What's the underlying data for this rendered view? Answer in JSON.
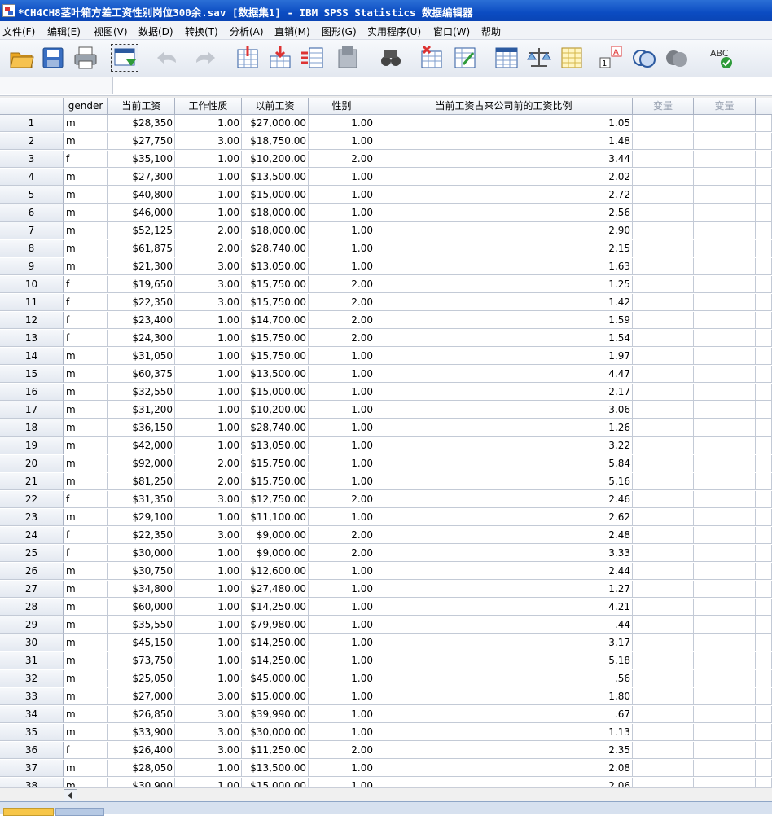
{
  "window": {
    "title": "*CH4CH8茎叶箱方差工资性别岗位300余.sav [数据集1] - IBM SPSS Statistics 数据编辑器"
  },
  "menu": [
    "文件(F)",
    "编辑(E)",
    "视图(V)",
    "数据(D)",
    "转换(T)",
    "分析(A)",
    "直销(M)",
    "图形(G)",
    "实用程序(U)",
    "窗口(W)",
    "帮助"
  ],
  "toolbar": [
    "open-folder-icon",
    "save-icon",
    "print-icon",
    "recall-dialog-icon",
    "undo-icon",
    "redo-icon",
    "goto-case-icon",
    "goto-variable-icon",
    "variables-icon",
    "run-descriptives-icon",
    "find-icon",
    "insert-cases-icon",
    "insert-variable-icon",
    "split-file-icon",
    "weight-cases-icon",
    "select-cases-icon",
    "value-labels-icon",
    "use-variable-sets-icon",
    "show-all-variables-icon",
    "spell-check-icon"
  ],
  "columns": [
    "gender",
    "当前工资",
    "工作性质",
    "以前工资",
    "性别",
    "当前工资占来公司前的工资比例",
    "变量",
    "变量"
  ],
  "rows": [
    [
      "1",
      "m",
      "$28,350",
      "1.00",
      "$27,000.00",
      "1.00",
      "1.05"
    ],
    [
      "2",
      "m",
      "$27,750",
      "3.00",
      "$18,750.00",
      "1.00",
      "1.48"
    ],
    [
      "3",
      "f",
      "$35,100",
      "1.00",
      "$10,200.00",
      "2.00",
      "3.44"
    ],
    [
      "4",
      "m",
      "$27,300",
      "1.00",
      "$13,500.00",
      "1.00",
      "2.02"
    ],
    [
      "5",
      "m",
      "$40,800",
      "1.00",
      "$15,000.00",
      "1.00",
      "2.72"
    ],
    [
      "6",
      "m",
      "$46,000",
      "1.00",
      "$18,000.00",
      "1.00",
      "2.56"
    ],
    [
      "7",
      "m",
      "$52,125",
      "2.00",
      "$18,000.00",
      "1.00",
      "2.90"
    ],
    [
      "8",
      "m",
      "$61,875",
      "2.00",
      "$28,740.00",
      "1.00",
      "2.15"
    ],
    [
      "9",
      "m",
      "$21,300",
      "3.00",
      "$13,050.00",
      "1.00",
      "1.63"
    ],
    [
      "10",
      "f",
      "$19,650",
      "3.00",
      "$15,750.00",
      "2.00",
      "1.25"
    ],
    [
      "11",
      "f",
      "$22,350",
      "3.00",
      "$15,750.00",
      "2.00",
      "1.42"
    ],
    [
      "12",
      "f",
      "$23,400",
      "1.00",
      "$14,700.00",
      "2.00",
      "1.59"
    ],
    [
      "13",
      "f",
      "$24,300",
      "1.00",
      "$15,750.00",
      "2.00",
      "1.54"
    ],
    [
      "14",
      "m",
      "$31,050",
      "1.00",
      "$15,750.00",
      "1.00",
      "1.97"
    ],
    [
      "15",
      "m",
      "$60,375",
      "1.00",
      "$13,500.00",
      "1.00",
      "4.47"
    ],
    [
      "16",
      "m",
      "$32,550",
      "1.00",
      "$15,000.00",
      "1.00",
      "2.17"
    ],
    [
      "17",
      "m",
      "$31,200",
      "1.00",
      "$10,200.00",
      "1.00",
      "3.06"
    ],
    [
      "18",
      "m",
      "$36,150",
      "1.00",
      "$28,740.00",
      "1.00",
      "1.26"
    ],
    [
      "19",
      "m",
      "$42,000",
      "1.00",
      "$13,050.00",
      "1.00",
      "3.22"
    ],
    [
      "20",
      "m",
      "$92,000",
      "2.00",
      "$15,750.00",
      "1.00",
      "5.84"
    ],
    [
      "21",
      "m",
      "$81,250",
      "2.00",
      "$15,750.00",
      "1.00",
      "5.16"
    ],
    [
      "22",
      "f",
      "$31,350",
      "3.00",
      "$12,750.00",
      "2.00",
      "2.46"
    ],
    [
      "23",
      "m",
      "$29,100",
      "1.00",
      "$11,100.00",
      "1.00",
      "2.62"
    ],
    [
      "24",
      "f",
      "$22,350",
      "3.00",
      "$9,000.00",
      "2.00",
      "2.48"
    ],
    [
      "25",
      "f",
      "$30,000",
      "1.00",
      "$9,000.00",
      "2.00",
      "3.33"
    ],
    [
      "26",
      "m",
      "$30,750",
      "1.00",
      "$12,600.00",
      "1.00",
      "2.44"
    ],
    [
      "27",
      "m",
      "$34,800",
      "1.00",
      "$27,480.00",
      "1.00",
      "1.27"
    ],
    [
      "28",
      "m",
      "$60,000",
      "1.00",
      "$14,250.00",
      "1.00",
      "4.21"
    ],
    [
      "29",
      "m",
      "$35,550",
      "1.00",
      "$79,980.00",
      "1.00",
      ".44"
    ],
    [
      "30",
      "m",
      "$45,150",
      "1.00",
      "$14,250.00",
      "1.00",
      "3.17"
    ],
    [
      "31",
      "m",
      "$73,750",
      "1.00",
      "$14,250.00",
      "1.00",
      "5.18"
    ],
    [
      "32",
      "m",
      "$25,050",
      "1.00",
      "$45,000.00",
      "1.00",
      ".56"
    ],
    [
      "33",
      "m",
      "$27,000",
      "3.00",
      "$15,000.00",
      "1.00",
      "1.80"
    ],
    [
      "34",
      "m",
      "$26,850",
      "3.00",
      "$39,990.00",
      "1.00",
      ".67"
    ],
    [
      "35",
      "m",
      "$33,900",
      "3.00",
      "$30,000.00",
      "1.00",
      "1.13"
    ],
    [
      "36",
      "f",
      "$26,400",
      "3.00",
      "$11,250.00",
      "2.00",
      "2.35"
    ],
    [
      "37",
      "m",
      "$28,050",
      "1.00",
      "$13,500.00",
      "1.00",
      "2.08"
    ],
    [
      "38",
      "m",
      "$30,900",
      "1.00",
      "$15,000.00",
      "1.00",
      "2.06"
    ]
  ]
}
